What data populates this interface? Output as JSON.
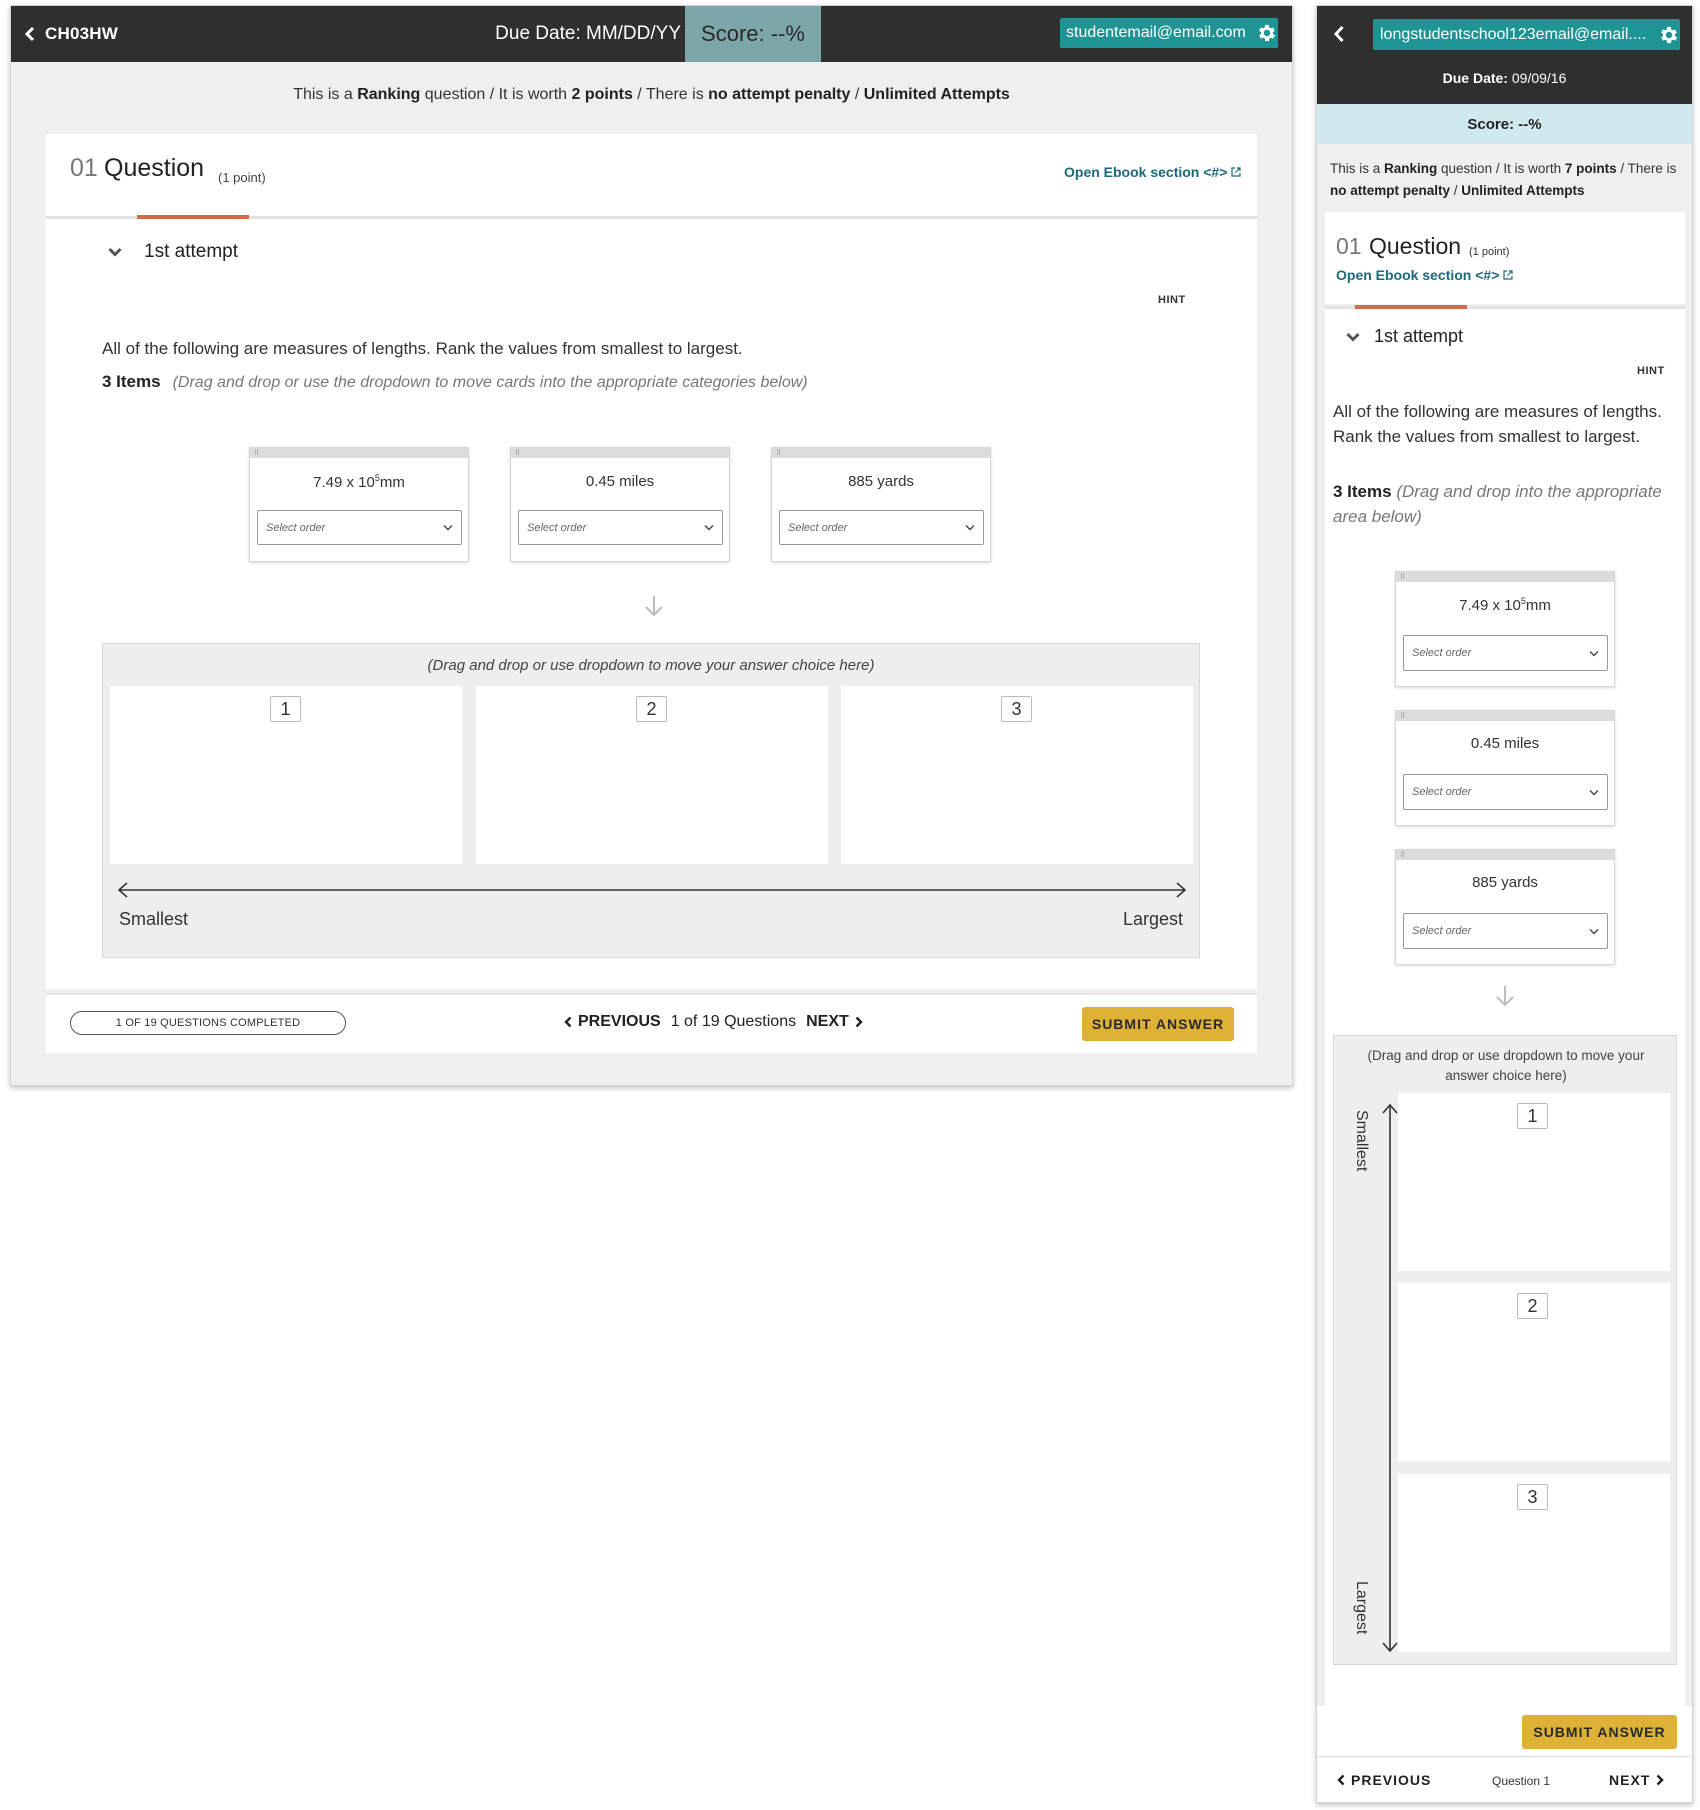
{
  "desktop": {
    "header": {
      "back_label": "CH03HW",
      "due_date": "Due Date: MM/DD/YY",
      "score": "Score: --%",
      "email": "studentemail@email.com"
    },
    "info": {
      "p1": "This is a ",
      "type": "Ranking",
      "p2": " question / It is worth ",
      "points": "2 points",
      "p3": " / There is ",
      "penalty": "no attempt penalty",
      "p4": " / ",
      "attempts": "Unlimited Attempts"
    },
    "question": {
      "number": "01",
      "title": "Question",
      "points": "(1 point)",
      "ebook_link": "Open Ebook section <#>"
    },
    "attempt_label": "1st attempt",
    "hint": "HINT",
    "prompt": "All of the following are measures of lengths. Rank the values from smallest to largest.",
    "items_count": "3 Items",
    "items_instruction": "(Drag and drop or use the dropdown to move cards into the appropriate categories below)",
    "cards": [
      {
        "base": "7.49 x 10",
        "exp": "5",
        "unit": "mm",
        "select": "Select order"
      },
      {
        "base": "0.45 miles",
        "exp": "",
        "unit": "",
        "select": "Select order"
      },
      {
        "base": "885 yards",
        "exp": "",
        "unit": "",
        "select": "Select order"
      }
    ],
    "dropzone": {
      "label": "(Drag and drop or use dropdown to move your answer choice here)",
      "slots": [
        "1",
        "2",
        "3"
      ],
      "smallest": "Smallest",
      "largest": "Largest"
    },
    "footer": {
      "progress": "1 OF 19 QUESTIONS COMPLETED",
      "previous": "PREVIOUS",
      "position": "1 of 19 Questions",
      "next": "NEXT",
      "submit": "SUBMIT ANSWER"
    }
  },
  "mobile": {
    "header": {
      "email": "longstudentschool123email@email....",
      "due_label": "Due Date:",
      "due_value": "09/09/16",
      "score": "Score: --%"
    },
    "info": {
      "p1": "This is a ",
      "type": "Ranking",
      "p2": " question / It is worth ",
      "points": "7 points",
      "p3": " / There is ",
      "penalty": "no attempt penalty",
      "p4": " / ",
      "attempts": "Unlimited Attempts"
    },
    "question": {
      "number": "01",
      "title": "Question",
      "points": "(1 point)",
      "ebook_link": "Open Ebook section <#>"
    },
    "attempt_label": "1st attempt",
    "hint": "HINT",
    "prompt": "All of the following are measures of lengths. Rank the values from smallest to largest.",
    "items_count": "3 Items",
    "items_instruction": "(Drag and drop into the appropriate area below)",
    "cards": [
      {
        "base": "7.49 x 10",
        "exp": "5",
        "unit": "mm",
        "select": "Select order"
      },
      {
        "base": "0.45 miles",
        "exp": "",
        "unit": "",
        "select": "Select order"
      },
      {
        "base": "885 yards",
        "exp": "",
        "unit": "",
        "select": "Select order"
      }
    ],
    "dropzone": {
      "label": "(Drag and drop or use dropdown to move your answer choice here)",
      "slots": [
        "1",
        "2",
        "3"
      ],
      "smallest": "Smallest",
      "largest": "Largest"
    },
    "footer": {
      "submit": "SUBMIT ANSWER",
      "previous": "PREVIOUS",
      "position": "Question 1",
      "next": "NEXT"
    }
  },
  "colors": {
    "header_bg": "#2f2f2f",
    "score_bg_desktop": "#7da6a8",
    "score_bg_mobile": "#cfe9ee",
    "email_bg": "#1e9494",
    "accent": "#d36a48",
    "submit_bg": "#deb236",
    "link": "#1b6a78"
  },
  "icons": {
    "back": "chevron-left-icon",
    "settings": "gear-icon",
    "external": "external-link-icon",
    "collapse": "chevron-down-icon",
    "drag": "grip-icon",
    "arrow_down": "arrow-down-icon"
  }
}
